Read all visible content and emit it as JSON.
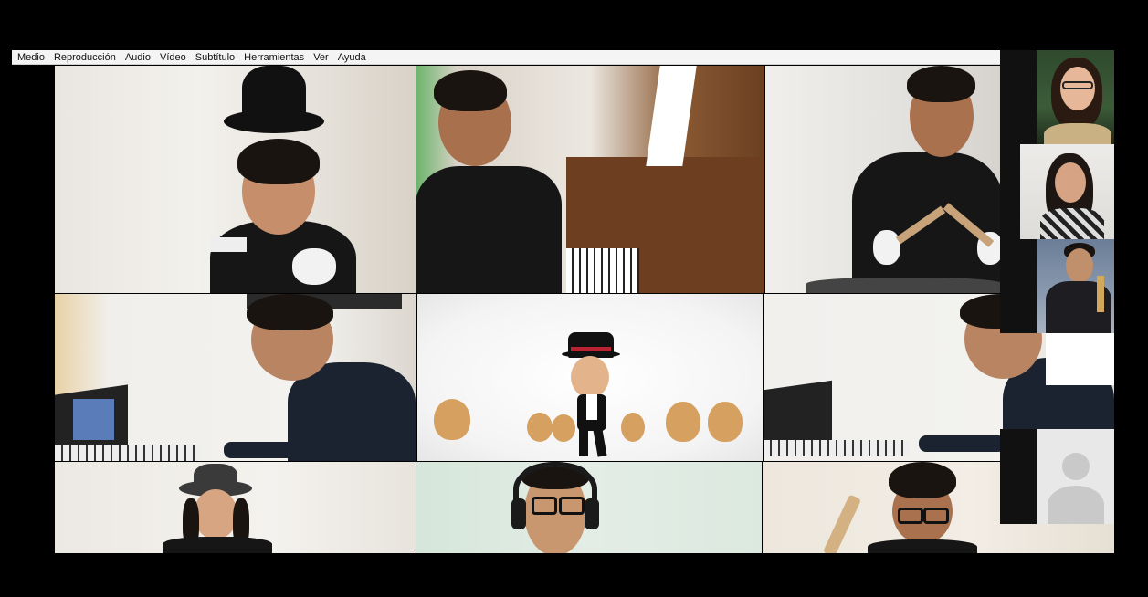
{
  "menu": {
    "items": [
      {
        "label": "Medio"
      },
      {
        "label": "Reproducción"
      },
      {
        "label": "Audio"
      },
      {
        "label": "Vídeo"
      },
      {
        "label": "Subtítulo"
      },
      {
        "label": "Herramientas"
      },
      {
        "label": "Ver"
      },
      {
        "label": "Ayuda"
      }
    ]
  },
  "colors": {
    "background": "#000000",
    "menubar": "#f4f4f4",
    "placeholder_avatar_bg": "#e8e8e8",
    "placeholder_avatar_fg": "#c9c9c9"
  },
  "grid": {
    "tiles": [
      {
        "subject": "girl-with-hat"
      },
      {
        "subject": "boy-at-piano"
      },
      {
        "subject": "boy-with-drumsticks"
      },
      {
        "subject": "teen-at-keyboard"
      },
      {
        "subject": "animated-dancer-with-chicks"
      },
      {
        "subject": "teen-at-keyboard"
      },
      {
        "subject": "girl-with-hat"
      },
      {
        "subject": "boy-with-headphones"
      },
      {
        "subject": "boy-with-drumsticks"
      }
    ]
  },
  "sidebar": {
    "participants": [
      {
        "subject": "woman-with-glasses"
      },
      {
        "subject": "woman-singer"
      },
      {
        "subject": "man-in-suit"
      },
      {
        "subject": "default-avatar-icon"
      }
    ]
  }
}
